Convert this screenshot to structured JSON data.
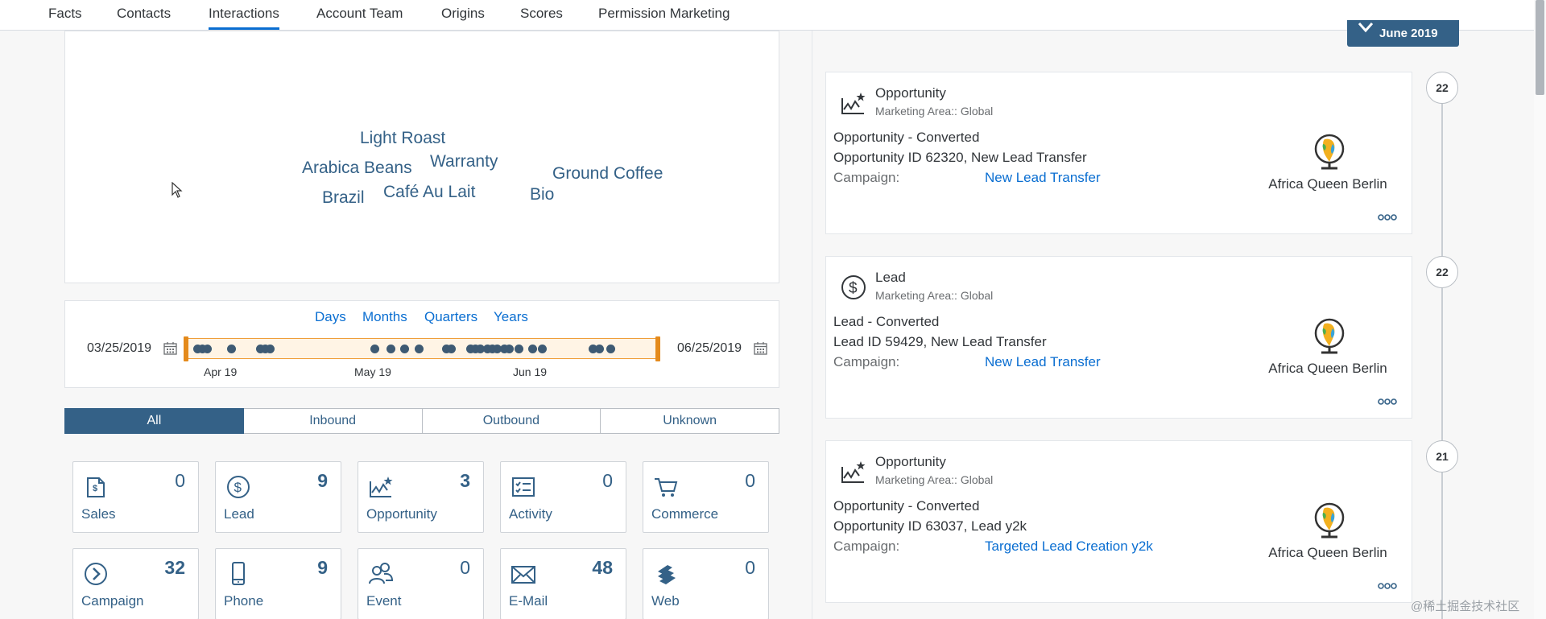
{
  "tabs": [
    {
      "label": "Facts"
    },
    {
      "label": "Contacts"
    },
    {
      "label": "Interactions"
    },
    {
      "label": "Account Team"
    },
    {
      "label": "Origins"
    },
    {
      "label": "Scores"
    },
    {
      "label": "Permission Marketing"
    }
  ],
  "active_tab": "Interactions",
  "word_cloud": [
    "Light Roast",
    "Arabica Beans",
    "Warranty",
    "Ground Coffee",
    "Brazil",
    "Café Au Lait",
    "Bio"
  ],
  "timeline_filter": {
    "ranges": [
      "Days",
      "Months",
      "Quarters",
      "Years"
    ],
    "start_date": "03/25/2019",
    "end_date": "06/25/2019",
    "ticks": [
      "Apr 19",
      "May 19",
      "Jun 19"
    ]
  },
  "direction_filter": {
    "options": [
      "All",
      "Inbound",
      "Outbound",
      "Unknown"
    ],
    "selected": "All"
  },
  "tiles": [
    {
      "label": "Sales",
      "count": "0",
      "icon": "sales-document-icon"
    },
    {
      "label": "Lead",
      "count": "9",
      "icon": "dollar-circle-icon"
    },
    {
      "label": "Opportunity",
      "count": "3",
      "icon": "opportunity-chart-icon"
    },
    {
      "label": "Activity",
      "count": "0",
      "icon": "activity-checklist-icon"
    },
    {
      "label": "Commerce",
      "count": "0",
      "icon": "shopping-cart-icon"
    },
    {
      "label": "Campaign",
      "count": "32",
      "icon": "campaign-arrow-icon"
    },
    {
      "label": "Phone",
      "count": "9",
      "icon": "phone-icon"
    },
    {
      "label": "Event",
      "count": "0",
      "icon": "event-people-icon"
    },
    {
      "label": "E-Mail",
      "count": "48",
      "icon": "email-icon"
    },
    {
      "label": "Web",
      "count": "0",
      "icon": "web-icon"
    }
  ],
  "month_button": "June 2019",
  "feed": [
    {
      "day": "22",
      "type": "Opportunity",
      "marketing_area": "Marketing Area:: Global",
      "line1": "Opportunity - Converted",
      "line2": "Opportunity ID 62320, New Lead Transfer",
      "campaign_label": "Campaign:",
      "campaign": "New Lead Transfer",
      "company": "Africa Queen Berlin"
    },
    {
      "day": "22",
      "type": "Lead",
      "marketing_area": "Marketing Area:: Global",
      "line1": "Lead - Converted",
      "line2": "Lead ID 59429, New Lead Transfer",
      "campaign_label": "Campaign:",
      "campaign": "New Lead Transfer",
      "company": "Africa Queen Berlin"
    },
    {
      "day": "21",
      "type": "Opportunity",
      "marketing_area": "Marketing Area:: Global",
      "line1": "Opportunity - Converted",
      "line2": "Opportunity ID 63037, Lead y2k",
      "campaign_label": "Campaign:",
      "campaign": "Targeted Lead Creation y2k",
      "company": "Africa Queen Berlin"
    }
  ],
  "watermark": "@稀土掘金技术社区",
  "colors": {
    "primary": "#346187",
    "link": "#0a6ed1",
    "slider_accent": "#e48a1b"
  }
}
